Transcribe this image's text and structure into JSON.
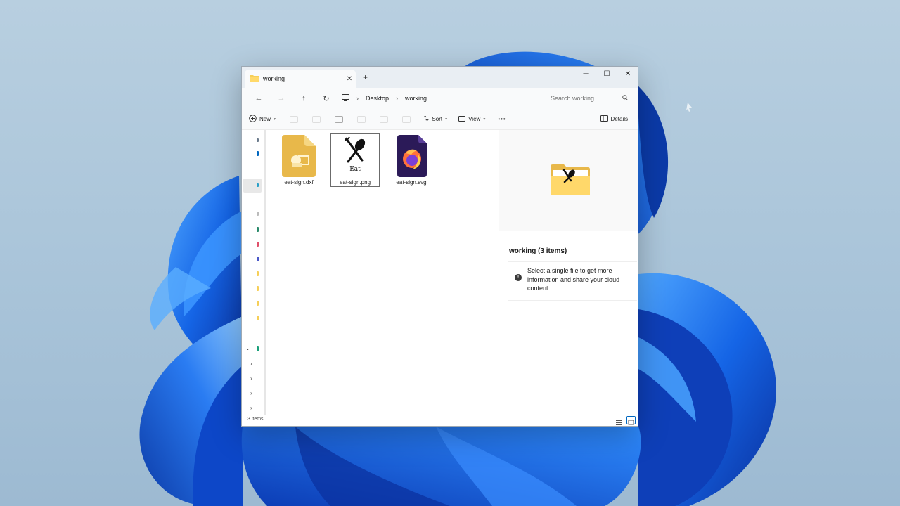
{
  "window": {
    "tab_title": "working",
    "new_tab": "+",
    "tab_close": "✕",
    "controls": {
      "minimize": "─",
      "maximize": "☐",
      "close": "✕"
    }
  },
  "navigation": {
    "back": "←",
    "forward": "→",
    "up": "↑",
    "refresh": "↻",
    "breadcrumb": [
      "Desktop",
      "working"
    ],
    "search_placeholder": "Search working"
  },
  "toolbar": {
    "new_label": "New",
    "sort_label": "Sort",
    "view_label": "View",
    "more_label": "•••",
    "details_label": "Details"
  },
  "files": [
    {
      "name": "eat-sign.dxf",
      "icon": "dxf-file-icon",
      "selected": false
    },
    {
      "name": "eat-sign.png",
      "icon": "png-thumbnail",
      "selected": true,
      "thumb_text": "Eat"
    },
    {
      "name": "eat-sign.svg",
      "icon": "firefox-svg-icon",
      "selected": false
    }
  ],
  "details_pane": {
    "title": "working (3 items)",
    "info": "Select a single file to get more information and share your cloud content.",
    "info_icon": "!"
  },
  "statusbar": {
    "items_count": "3 items"
  },
  "colors": {
    "accent": "#0067c0",
    "folder_yellow": "#f6cf58",
    "wallpaper_blue": "#1a64d6"
  }
}
